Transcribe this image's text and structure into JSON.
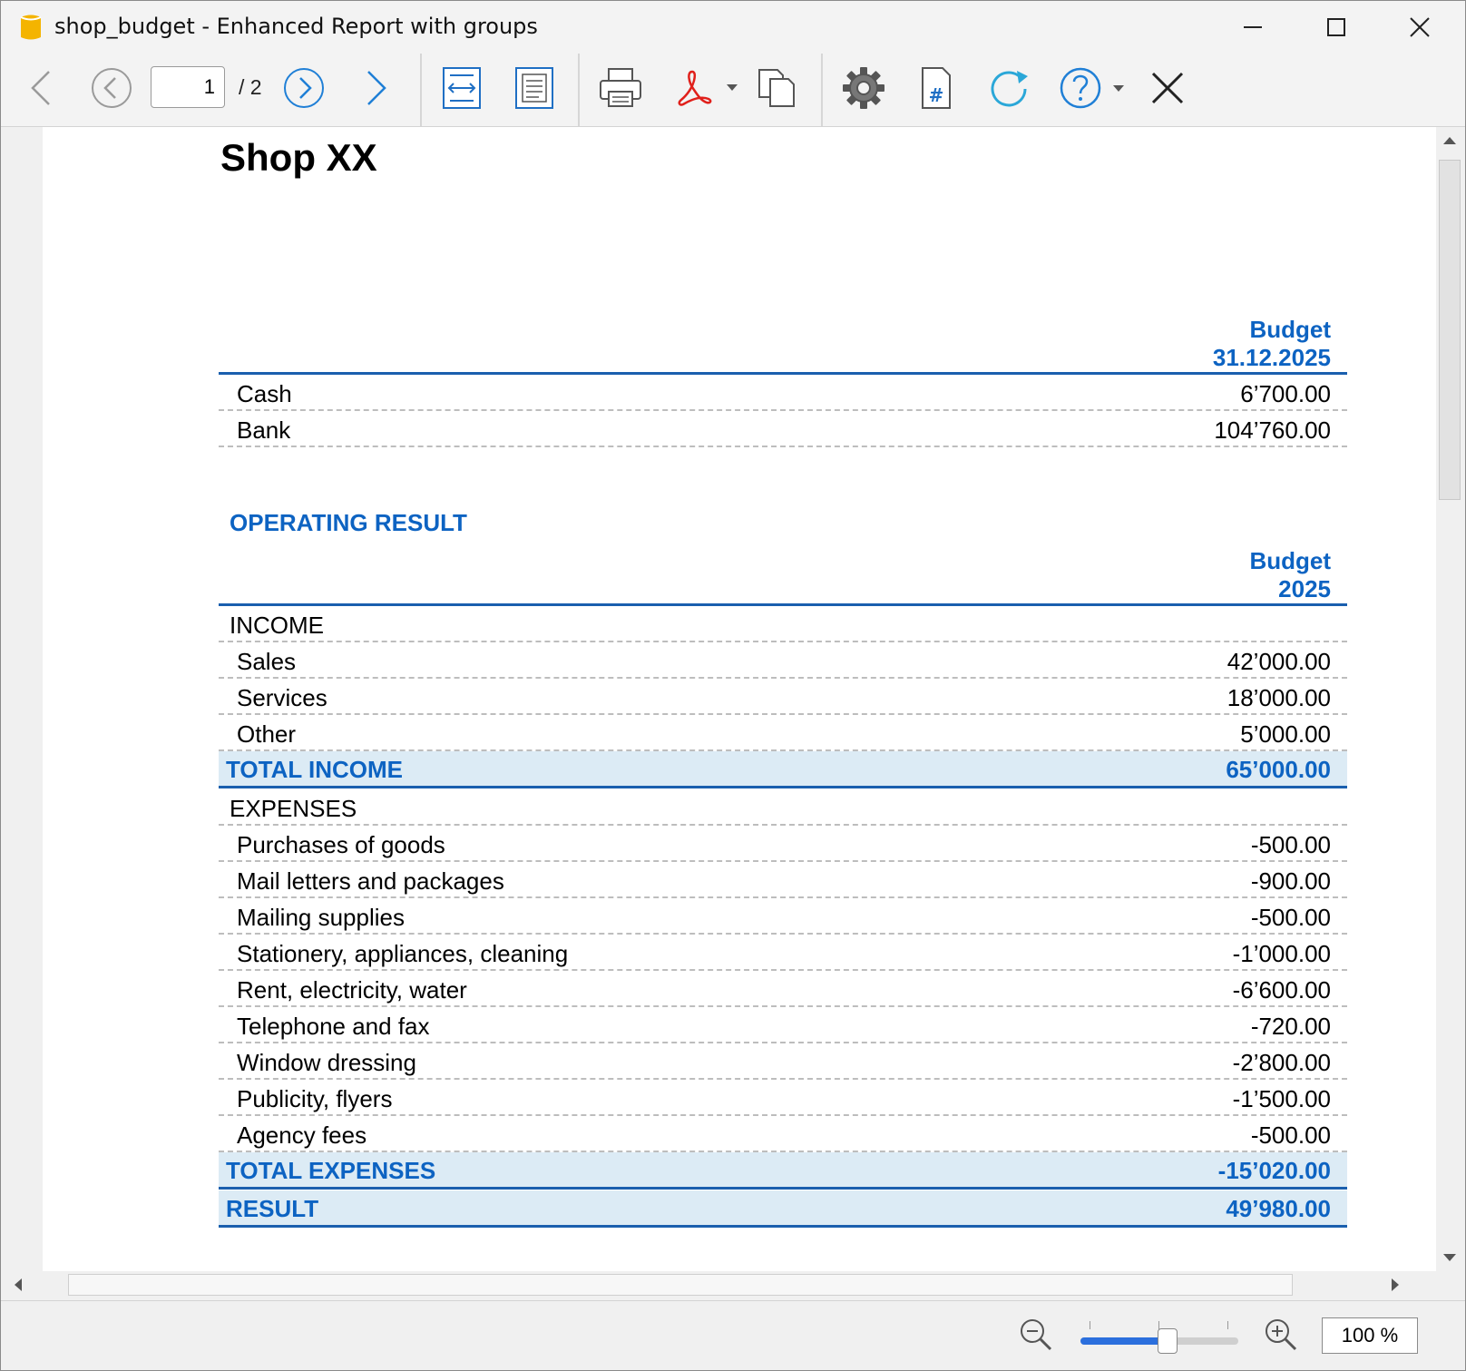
{
  "window": {
    "title": "shop_budget - Enhanced Report with groups",
    "controls": [
      "minimize",
      "maximize",
      "close"
    ]
  },
  "toolbar": {
    "current_page": "1",
    "total_pages": "/ 2",
    "icons": [
      "back-arrow-icon",
      "previous-page-icon",
      "next-page-icon",
      "forward-arrow-icon",
      "fit-width-icon",
      "fit-page-icon",
      "print-icon",
      "pdf-icon",
      "copy-icon",
      "settings-icon",
      "page-number-icon",
      "refresh-icon",
      "help-icon",
      "close-icon"
    ]
  },
  "report": {
    "title": "Shop XX",
    "balance_header": {
      "line1": "Budget",
      "line2": "31.12.2025"
    },
    "balance_rows": [
      {
        "label": "Cash",
        "value": "6’700.00"
      },
      {
        "label": "Bank",
        "value": "104’760.00"
      }
    ],
    "operating_title": "OPERATING RESULT",
    "operating_header": {
      "line1": "Budget",
      "line2": "2025"
    },
    "income_group": "INCOME",
    "income_rows": [
      {
        "label": "Sales",
        "value": "42’000.00"
      },
      {
        "label": "Services",
        "value": "18’000.00"
      },
      {
        "label": "Other",
        "value": "5’000.00"
      }
    ],
    "total_income": {
      "label": "TOTAL INCOME",
      "value": "65’000.00"
    },
    "expenses_group": "EXPENSES",
    "expense_rows": [
      {
        "label": "Purchases of goods",
        "value": "-500.00"
      },
      {
        "label": "Mail letters and packages",
        "value": "-900.00"
      },
      {
        "label": "Mailing supplies",
        "value": "-500.00"
      },
      {
        "label": "Stationery, appliances, cleaning",
        "value": "-1’000.00"
      },
      {
        "label": "Rent, electricity, water",
        "value": "-6’600.00"
      },
      {
        "label": "Telephone and fax",
        "value": "-720.00"
      },
      {
        "label": "Window dressing",
        "value": "-2’800.00"
      },
      {
        "label": "Publicity, flyers",
        "value": "-1’500.00"
      },
      {
        "label": "Agency fees",
        "value": "-500.00"
      }
    ],
    "total_expenses": {
      "label": "TOTAL EXPENSES",
      "value": "-15’020.00"
    },
    "result": {
      "label": "RESULT",
      "value": "49’980.00"
    }
  },
  "statusbar": {
    "zoom_label": "100 %",
    "zoom_level": 0.55
  },
  "colors": {
    "accent": "#0d63c2",
    "total_bg": "#dcebf5",
    "rule": "#1a5fae",
    "pdf_red": "#e0201b",
    "refresh_teal": "#2aa7d8"
  }
}
